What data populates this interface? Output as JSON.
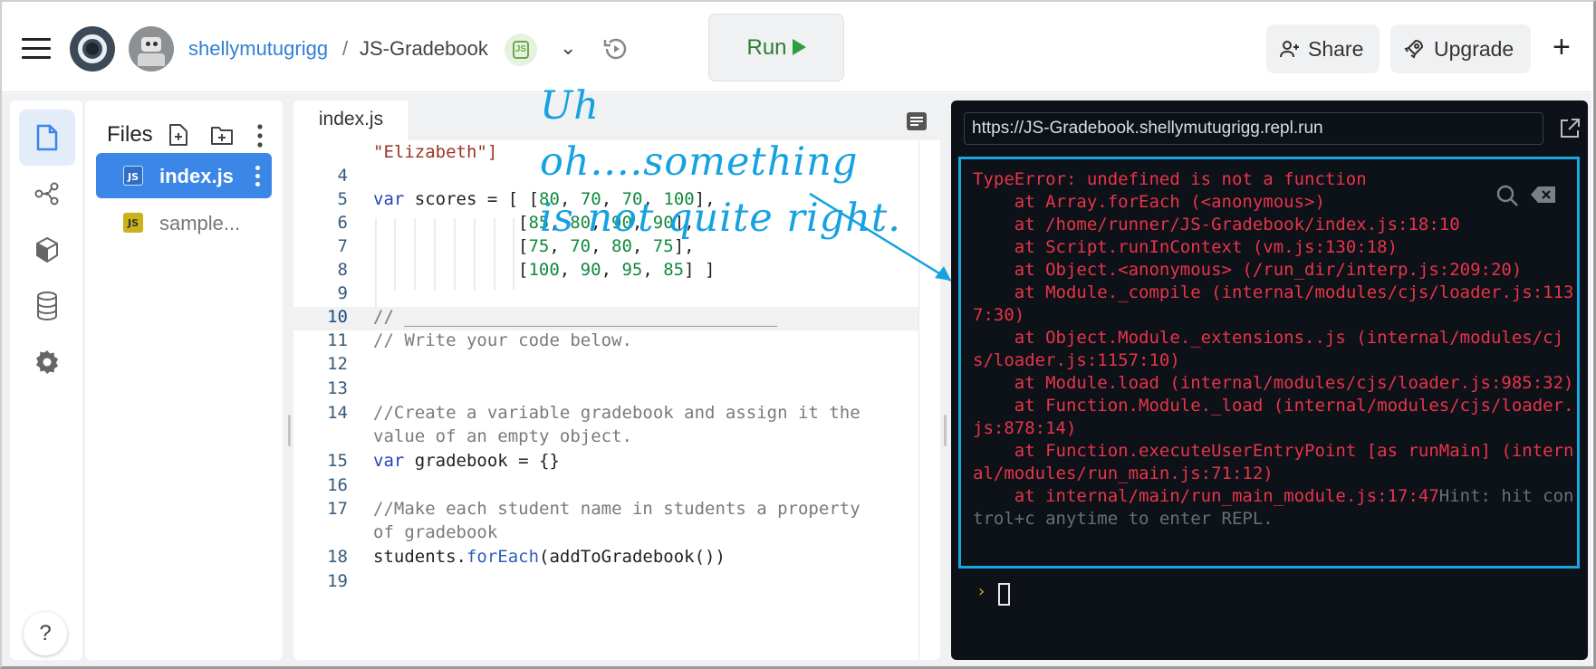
{
  "header": {
    "username": "shellymutugrigg",
    "separator": "/",
    "repl_name": "JS-Gradebook",
    "node_badge": "JS",
    "run_label": "Run",
    "share_label": "Share",
    "upgrade_label": "Upgrade",
    "plus": "+"
  },
  "sidebar": {
    "icons": [
      "files-icon",
      "share-graph-icon",
      "package-icon",
      "database-icon",
      "settings-icon"
    ],
    "help": "?"
  },
  "files": {
    "title": "Files",
    "items": [
      {
        "badge": "JS",
        "name": "index.js",
        "active": true
      },
      {
        "badge": "JS",
        "name": "sample..."
      }
    ]
  },
  "editor": {
    "tab": "index.js",
    "lines": [
      {
        "n": "",
        "text": "\"Elizabeth\"]"
      },
      {
        "n": "4",
        "text": ""
      },
      {
        "n": "5",
        "text": "var scores = [ [80, 70, 70, 100],"
      },
      {
        "n": "6",
        "text": "[85, 80, 90, 90],"
      },
      {
        "n": "7",
        "text": "[75, 70, 80, 75],"
      },
      {
        "n": "8",
        "text": "[100, 90, 95, 85] ]"
      },
      {
        "n": "9",
        "text": ""
      },
      {
        "n": "10",
        "text": "// ____________________________________"
      },
      {
        "n": "11",
        "text": "// Write your code below."
      },
      {
        "n": "12",
        "text": ""
      },
      {
        "n": "13",
        "text": ""
      },
      {
        "n": "14",
        "text": "//Create a variable gradebook and assign it the"
      },
      {
        "n": "",
        "text": "value of an empty object."
      },
      {
        "n": "15",
        "text": "var gradebook = {}"
      },
      {
        "n": "16",
        "text": ""
      },
      {
        "n": "17",
        "text": "//Make each student name in students a property"
      },
      {
        "n": "",
        "text": "of gradebook"
      },
      {
        "n": "18",
        "text": "students.forEach(addToGradebook())"
      },
      {
        "n": "19",
        "text": ""
      }
    ]
  },
  "console": {
    "url": "https://JS-Gradebook.shellymutugrigg.repl.run",
    "output": "TypeError: undefined is not a function\n    at Array.forEach (<anonymous>)\n    at /home/runner/JS-Gradebook/index.js:18:10\n    at Script.runInContext (vm.js:130:18)\n    at Object.<anonymous> (/run_dir/interp.js:209:20)\n    at Module._compile (internal/modules/cjs/loader.js:1137:30)\n    at Object.Module._extensions..js (internal/modules/cjs/loader.js:1157:10)\n    at Module.load (internal/modules/cjs/loader.js:985:32)\n    at Function.Module._load (internal/modules/cjs/loader.js:878:14)\n    at Function.executeUserEntryPoint [as runMain] (internal/modules/run_main.js:71:12)\n    at internal/main/run_main_module.js:17:47",
    "hint": "Hint: hit control+c anytime to enter REPL.",
    "prompt": "›"
  },
  "annotation": {
    "line1": "Uh oh....something",
    "line2": "is not quite right."
  },
  "colors": {
    "accent": "#3b86e6",
    "run_green": "#2e7d32",
    "error_red": "#e8344a",
    "annotation_blue": "#16a2e0",
    "console_bg": "#0d1118"
  }
}
